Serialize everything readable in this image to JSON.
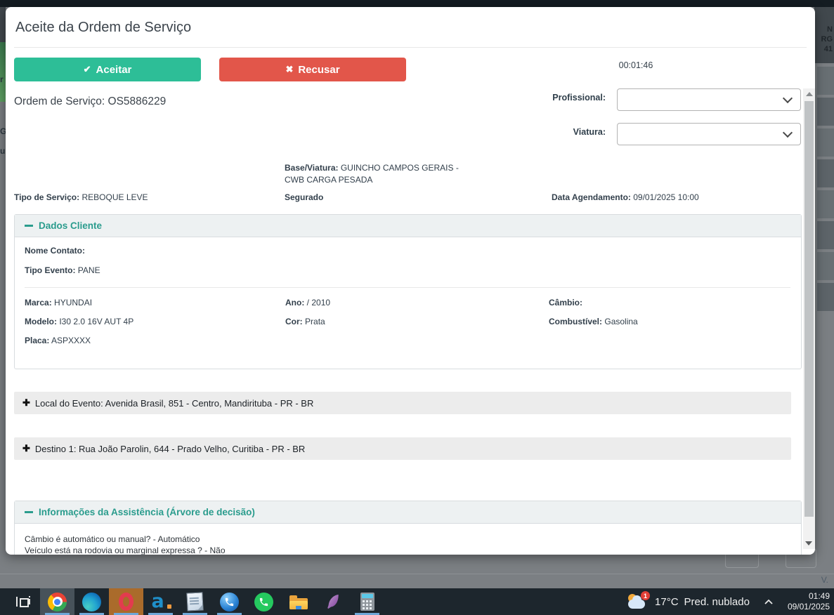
{
  "overlay": {
    "fragments_right": [
      "N",
      "RG",
      "41"
    ],
    "fragments_left": [
      "r",
      "Gr",
      "u"
    ],
    "version_text": "V."
  },
  "modal": {
    "title": "Aceite da Ordem de Serviço",
    "timer": "00:01:46",
    "icons": {
      "check": "✔",
      "cross": "✖",
      "plus": "✚"
    },
    "buttons": {
      "accept": "Aceitar",
      "refuse": "Recusar"
    },
    "order": "Ordem de Serviço: OS5886229",
    "fields": {
      "professional_label": "Profissional:",
      "vehicle_label": "Viatura:"
    },
    "summary": {
      "base_label": "Base/Viatura:",
      "base_value": "GUINCHO CAMPOS GERAIS - CWB CARGA PESADA",
      "service_label": "Tipo de Serviço:",
      "service_value": "REBOQUE LEVE",
      "insured": "Segurado",
      "schedule_label": "Data Agendamento:",
      "schedule_value": "09/01/2025 10:00"
    },
    "client": {
      "title": "Dados Cliente",
      "contact_label": "Nome Contato:",
      "event_label": "Tipo Evento:",
      "event_value": "PANE",
      "brand_label": "Marca:",
      "brand_value": "HYUNDAI",
      "model_label": "Modelo:",
      "model_value": "I30 2.0 16V AUT 4P",
      "plate_label": "Placa:",
      "plate_value": "ASPXXXX",
      "year_label": "Ano:",
      "year_value": "/ 2010",
      "color_label": "Cor:",
      "color_value": "Prata",
      "gearbox_label": "Câmbio:",
      "gearbox_value": "",
      "fuel_label": "Combustível:",
      "fuel_value": "Gasolina"
    },
    "locations": {
      "event": "Local do Evento: Avenida Brasil, 851 - Centro, Mandirituba - PR - BR",
      "destination": "Destino 1: Rua João Parolin, 644 - Prado Velho, Curitiba - PR - BR"
    },
    "assistance": {
      "title": "Informações da Assistência (Árvore de decisão)",
      "lines": [
        "Câmbio é automático ou manual? - Automático",
        "Veículo está na rodovia ou marginal expressa ? - Não"
      ]
    }
  },
  "taskbar": {
    "glyphs": {
      "opera": "O",
      "a_app": "a"
    },
    "tray": {
      "badge": "1",
      "temperature": "17°C",
      "condition": "Pred. nublado",
      "time": "01:49",
      "date": "09/01/2025"
    }
  }
}
